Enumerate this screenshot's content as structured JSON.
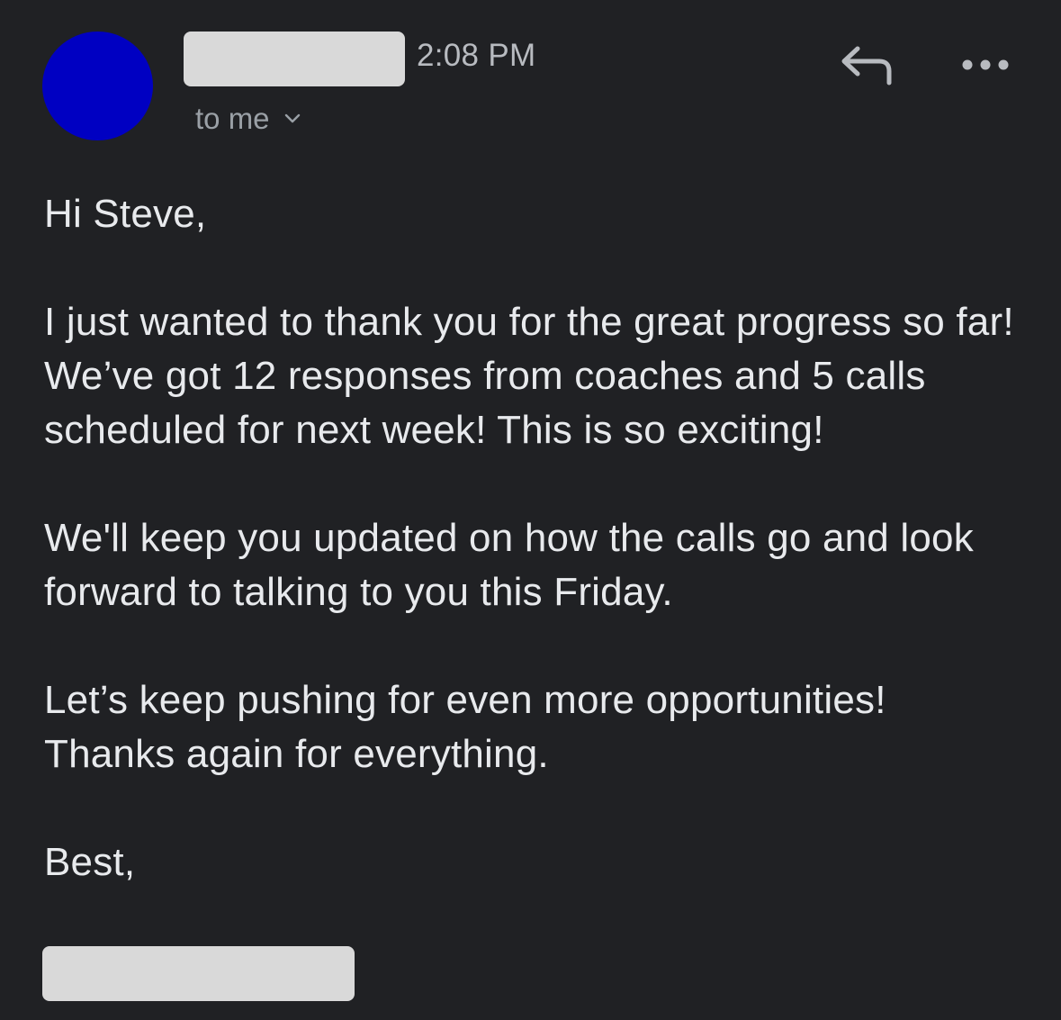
{
  "header": {
    "time": "2:08 PM",
    "recipient_label": "to me",
    "avatar_color": "#0000c2"
  },
  "icons": {
    "reply": "reply-icon",
    "more": "more-options-icon",
    "chevron": "chevron-down-icon"
  },
  "body": {
    "greeting": "Hi Steve,",
    "paragraph1": "I just wanted to thank you for the great progress so far! We’ve got 12 responses from coaches and 5 calls scheduled for next week! This is so exciting!",
    "paragraph2": "We'll keep you updated on how the calls go and look forward to talking to you this Friday.",
    "paragraph3_line1": "Let’s keep pushing for even more opportunities!",
    "paragraph3_line2": "Thanks again for everything.",
    "closing": "Best,"
  }
}
